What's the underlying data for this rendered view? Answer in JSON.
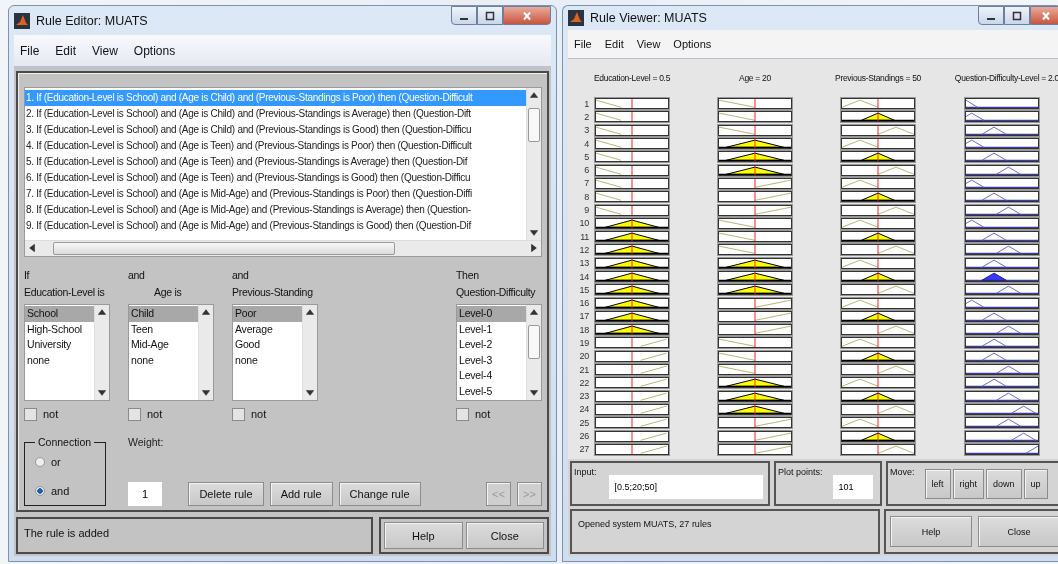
{
  "rule_editor": {
    "window": {
      "title": "Rule Editor: MUATS"
    },
    "menu": [
      "File",
      "Edit",
      "View",
      "Options"
    ],
    "rules": [
      {
        "text": "1. If (Education-Level is School) and (Age is Child) and (Previous-Standings is Poor) then (Question-Difficult",
        "selected": true
      },
      {
        "text": "2. If (Education-Level is School) and (Age is Child) and (Previous-Standings is Average) then (Question-Dift",
        "selected": false
      },
      {
        "text": "3. If (Education-Level is School) and (Age is Child) and (Previous-Standings is Good) then (Question-Difficu",
        "selected": false
      },
      {
        "text": "4. If (Education-Level is School) and (Age is Teen) and (Previous-Standings is Poor) then (Question-Difficult",
        "selected": false
      },
      {
        "text": "5. If (Education-Level is School) and (Age is Teen) and (Previous-Standings is Average) then (Question-Dif",
        "selected": false
      },
      {
        "text": "6. If (Education-Level is School) and (Age is Teen) and (Previous-Standings is Good) then (Question-Difficu",
        "selected": false
      },
      {
        "text": "7. If (Education-Level is School) and (Age is Mid-Age) and (Previous-Standings is Poor) then (Question-Diffi",
        "selected": false
      },
      {
        "text": "8. If (Education-Level is School) and (Age is Mid-Age) and (Previous-Standings is Average) then (Question-",
        "selected": false
      },
      {
        "text": "9. If (Education-Level is School) and (Age is Mid-Age) and (Previous-Standings is Good) then (Question-Dif",
        "selected": false
      }
    ],
    "variables": [
      {
        "kind": "input",
        "caption": "If",
        "label": "Education-Level is",
        "options": [
          {
            "label": "School",
            "selected": true
          },
          {
            "label": "High-School",
            "selected": false
          },
          {
            "label": "University",
            "selected": false
          },
          {
            "label": "none",
            "selected": false
          }
        ],
        "negate": {
          "label": "not",
          "checked": false
        }
      },
      {
        "kind": "input",
        "caption": "and",
        "label": "Age is",
        "options": [
          {
            "label": "Child",
            "selected": true
          },
          {
            "label": "Teen",
            "selected": false
          },
          {
            "label": "Mid-Age",
            "selected": false
          },
          {
            "label": "none",
            "selected": false
          }
        ],
        "negate": {
          "label": "not",
          "checked": false
        }
      },
      {
        "kind": "input",
        "caption": "and",
        "label": "Previous-Standing",
        "options": [
          {
            "label": "Poor",
            "selected": true
          },
          {
            "label": "Average",
            "selected": false
          },
          {
            "label": "Good",
            "selected": false
          },
          {
            "label": "none",
            "selected": false
          }
        ],
        "negate": {
          "label": "not",
          "checked": false
        }
      },
      {
        "kind": "output",
        "caption": "Then",
        "label": "Question-Difficulty",
        "options": [
          {
            "label": "Level-0",
            "selected": true
          },
          {
            "label": "Level-1",
            "selected": false
          },
          {
            "label": "Level-2",
            "selected": false
          },
          {
            "label": "Level-3",
            "selected": false
          },
          {
            "label": "Level-4",
            "selected": false
          },
          {
            "label": "Level-5",
            "selected": false
          }
        ],
        "negate": {
          "label": "not",
          "checked": false
        }
      }
    ],
    "connection": {
      "title": "Connection",
      "options": [
        {
          "label": "or",
          "selected": false
        },
        {
          "label": "and",
          "selected": true
        }
      ]
    },
    "weight": {
      "label": "Weight:",
      "value": "1"
    },
    "buttons": [
      {
        "kind": "edit",
        "label": "Delete rule",
        "disabled": false
      },
      {
        "kind": "edit",
        "label": "Add rule",
        "disabled": false
      },
      {
        "kind": "edit",
        "label": "Change rule",
        "disabled": false
      },
      {
        "kind": "nav",
        "label": "<<",
        "disabled": true
      },
      {
        "kind": "nav",
        "label": ">>",
        "disabled": true
      }
    ],
    "status": "The rule is added",
    "footer_buttons": [
      "Help",
      "Close"
    ]
  },
  "rule_viewer": {
    "window": {
      "title": "Rule Viewer: MUATS"
    },
    "menu": [
      "File",
      "Edit",
      "View",
      "Options"
    ],
    "columns": [
      {
        "label": "Education-Level = 0.5"
      },
      {
        "label": "Age = 20"
      },
      {
        "label": "Previous-Standings = 50"
      },
      {
        "label": "Question-Difficulty-Level = 2.0"
      }
    ],
    "rows": [
      {
        "label": "1",
        "inputs": [
          {
            "kind": "low",
            "fired": false
          },
          {
            "kind": "low",
            "fired": false
          },
          {
            "kind": "low",
            "fired": false
          }
        ],
        "output": {
          "kind": "level-0",
          "fired": false
        }
      },
      {
        "label": "2",
        "inputs": [
          {
            "kind": "low",
            "fired": false
          },
          {
            "kind": "low",
            "fired": false
          },
          {
            "kind": "mid",
            "fired": true
          }
        ],
        "output": {
          "kind": "level-1",
          "fired": false
        }
      },
      {
        "label": "3",
        "inputs": [
          {
            "kind": "low",
            "fired": false
          },
          {
            "kind": "low",
            "fired": false
          },
          {
            "kind": "high",
            "fired": false
          }
        ],
        "output": {
          "kind": "level-2",
          "fired": false
        }
      },
      {
        "label": "4",
        "inputs": [
          {
            "kind": "low",
            "fired": false
          },
          {
            "kind": "mid",
            "fired": true
          },
          {
            "kind": "low",
            "fired": false
          }
        ],
        "output": {
          "kind": "level-1",
          "fired": false
        }
      },
      {
        "label": "5",
        "inputs": [
          {
            "kind": "low",
            "fired": false
          },
          {
            "kind": "mid",
            "fired": true
          },
          {
            "kind": "mid",
            "fired": true
          }
        ],
        "output": {
          "kind": "level-2",
          "fired": false
        }
      },
      {
        "label": "6",
        "inputs": [
          {
            "kind": "low",
            "fired": false
          },
          {
            "kind": "mid",
            "fired": true
          },
          {
            "kind": "high",
            "fired": false
          }
        ],
        "output": {
          "kind": "level-3",
          "fired": false
        }
      },
      {
        "label": "7",
        "inputs": [
          {
            "kind": "low",
            "fired": false
          },
          {
            "kind": "high",
            "fired": false
          },
          {
            "kind": "low",
            "fired": false
          }
        ],
        "output": {
          "kind": "level-1",
          "fired": false
        }
      },
      {
        "label": "8",
        "inputs": [
          {
            "kind": "low",
            "fired": false
          },
          {
            "kind": "high",
            "fired": false
          },
          {
            "kind": "mid",
            "fired": true
          }
        ],
        "output": {
          "kind": "level-2",
          "fired": false
        }
      },
      {
        "label": "9",
        "inputs": [
          {
            "kind": "low",
            "fired": false
          },
          {
            "kind": "high",
            "fired": false
          },
          {
            "kind": "high",
            "fired": false
          }
        ],
        "output": {
          "kind": "level-3",
          "fired": false
        }
      },
      {
        "label": "10",
        "inputs": [
          {
            "kind": "mid",
            "fired": true
          },
          {
            "kind": "low",
            "fired": false
          },
          {
            "kind": "low",
            "fired": false
          }
        ],
        "output": {
          "kind": "level-1",
          "fired": false
        }
      },
      {
        "label": "11",
        "inputs": [
          {
            "kind": "mid",
            "fired": true
          },
          {
            "kind": "low",
            "fired": false
          },
          {
            "kind": "mid",
            "fired": true
          }
        ],
        "output": {
          "kind": "level-2",
          "fired": false
        }
      },
      {
        "label": "12",
        "inputs": [
          {
            "kind": "mid",
            "fired": true
          },
          {
            "kind": "low",
            "fired": false
          },
          {
            "kind": "high",
            "fired": false
          }
        ],
        "output": {
          "kind": "level-3",
          "fired": false
        }
      },
      {
        "label": "13",
        "inputs": [
          {
            "kind": "mid",
            "fired": true
          },
          {
            "kind": "mid",
            "fired": true
          },
          {
            "kind": "low",
            "fired": false
          }
        ],
        "output": {
          "kind": "level-2",
          "fired": false
        }
      },
      {
        "label": "14",
        "inputs": [
          {
            "kind": "mid",
            "fired": true
          },
          {
            "kind": "mid",
            "fired": true
          },
          {
            "kind": "mid",
            "fired": true
          }
        ],
        "output": {
          "kind": "level-2",
          "fired": true
        }
      },
      {
        "label": "15",
        "inputs": [
          {
            "kind": "mid",
            "fired": true
          },
          {
            "kind": "mid",
            "fired": true
          },
          {
            "kind": "high",
            "fired": false
          }
        ],
        "output": {
          "kind": "level-3",
          "fired": false
        }
      },
      {
        "label": "16",
        "inputs": [
          {
            "kind": "mid",
            "fired": true
          },
          {
            "kind": "high",
            "fired": false
          },
          {
            "kind": "low",
            "fired": false
          }
        ],
        "output": {
          "kind": "level-1",
          "fired": false
        }
      },
      {
        "label": "17",
        "inputs": [
          {
            "kind": "mid",
            "fired": true
          },
          {
            "kind": "high",
            "fired": false
          },
          {
            "kind": "mid",
            "fired": true
          }
        ],
        "output": {
          "kind": "level-2",
          "fired": false
        }
      },
      {
        "label": "18",
        "inputs": [
          {
            "kind": "mid",
            "fired": true
          },
          {
            "kind": "high",
            "fired": false
          },
          {
            "kind": "high",
            "fired": false
          }
        ],
        "output": {
          "kind": "level-3",
          "fired": false
        }
      },
      {
        "label": "19",
        "inputs": [
          {
            "kind": "high",
            "fired": false
          },
          {
            "kind": "low",
            "fired": false
          },
          {
            "kind": "low",
            "fired": false
          }
        ],
        "output": {
          "kind": "level-2",
          "fired": false
        }
      },
      {
        "label": "20",
        "inputs": [
          {
            "kind": "high",
            "fired": false
          },
          {
            "kind": "low",
            "fired": false
          },
          {
            "kind": "mid",
            "fired": true
          }
        ],
        "output": {
          "kind": "level-2",
          "fired": false
        }
      },
      {
        "label": "21",
        "inputs": [
          {
            "kind": "high",
            "fired": false
          },
          {
            "kind": "low",
            "fired": false
          },
          {
            "kind": "high",
            "fired": false
          }
        ],
        "output": {
          "kind": "level-3",
          "fired": false
        }
      },
      {
        "label": "22",
        "inputs": [
          {
            "kind": "high",
            "fired": false
          },
          {
            "kind": "mid",
            "fired": true
          },
          {
            "kind": "low",
            "fired": false
          }
        ],
        "output": {
          "kind": "level-2",
          "fired": false
        }
      },
      {
        "label": "23",
        "inputs": [
          {
            "kind": "high",
            "fired": false
          },
          {
            "kind": "mid",
            "fired": true
          },
          {
            "kind": "mid",
            "fired": true
          }
        ],
        "output": {
          "kind": "level-3",
          "fired": false
        }
      },
      {
        "label": "24",
        "inputs": [
          {
            "kind": "high",
            "fired": false
          },
          {
            "kind": "mid",
            "fired": true
          },
          {
            "kind": "high",
            "fired": false
          }
        ],
        "output": {
          "kind": "level-4",
          "fired": false
        }
      },
      {
        "label": "25",
        "inputs": [
          {
            "kind": "high",
            "fired": false
          },
          {
            "kind": "high",
            "fired": false
          },
          {
            "kind": "low",
            "fired": false
          }
        ],
        "output": {
          "kind": "level-3",
          "fired": false
        }
      },
      {
        "label": "26",
        "inputs": [
          {
            "kind": "high",
            "fired": false
          },
          {
            "kind": "high",
            "fired": false
          },
          {
            "kind": "mid",
            "fired": true
          }
        ],
        "output": {
          "kind": "level-4",
          "fired": false
        }
      },
      {
        "label": "27",
        "inputs": [
          {
            "kind": "high",
            "fired": false
          },
          {
            "kind": "high",
            "fired": false
          },
          {
            "kind": "high",
            "fired": false
          }
        ],
        "output": {
          "kind": "level-5",
          "fired": false
        }
      }
    ],
    "input_field": {
      "label": "Input:",
      "value": "[0.5;20;50]"
    },
    "plot_points": {
      "label": "Plot points:",
      "value": "101"
    },
    "move": {
      "label": "Move:",
      "buttons": [
        "left",
        "right",
        "down",
        "up"
      ]
    },
    "status": "Opened system MUATS, 27 rules",
    "footer_buttons": [
      "Help",
      "Close"
    ]
  }
}
